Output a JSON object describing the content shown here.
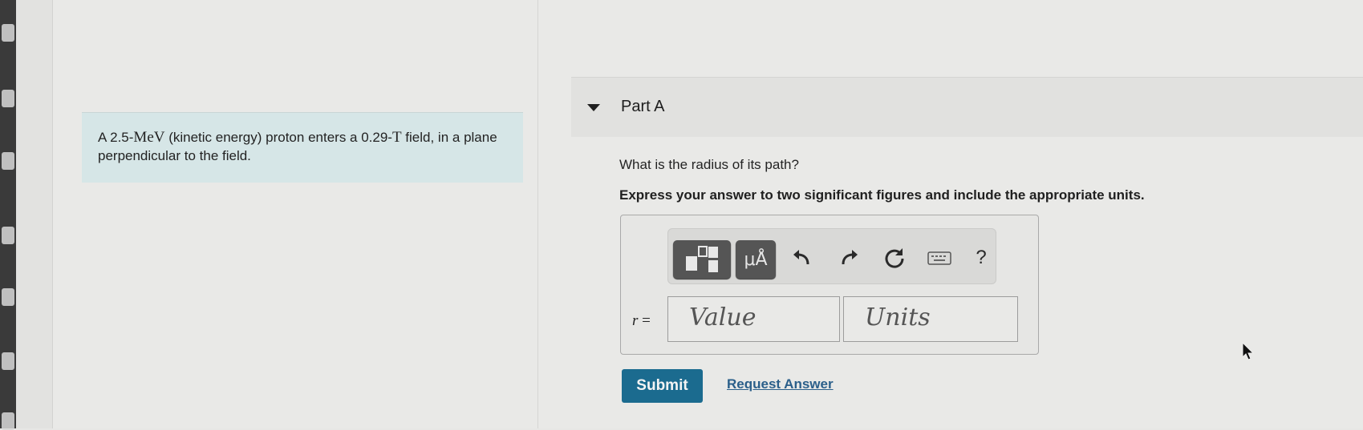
{
  "problem": {
    "text_prefix": "A 2.5-",
    "unit_mev": "MeV",
    "text_mid": " (kinetic energy) proton enters a 0.29-",
    "unit_t": "T",
    "text_suffix": " field, in a plane perpendicular to the field."
  },
  "part": {
    "title": "Part A",
    "question": "What is the radius of its path?",
    "instruction": "Express your answer to two significant figures and include the appropriate units."
  },
  "toolbar": {
    "templates_icon": "templates-icon",
    "units_label": "μÅ",
    "undo_icon": "undo-icon",
    "redo_icon": "redo-icon",
    "reset_icon": "reset-icon",
    "keyboard_icon": "keyboard-icon",
    "help_label": "?"
  },
  "answer": {
    "variable": "r",
    "equals": " =",
    "value_placeholder": "Value",
    "units_placeholder": "Units"
  },
  "actions": {
    "submit_label": "Submit",
    "request_label": "Request Answer"
  },
  "colors": {
    "submit_bg": "#1b6b8f",
    "problem_bg": "#d6e6e7",
    "link": "#2b5f8a"
  }
}
